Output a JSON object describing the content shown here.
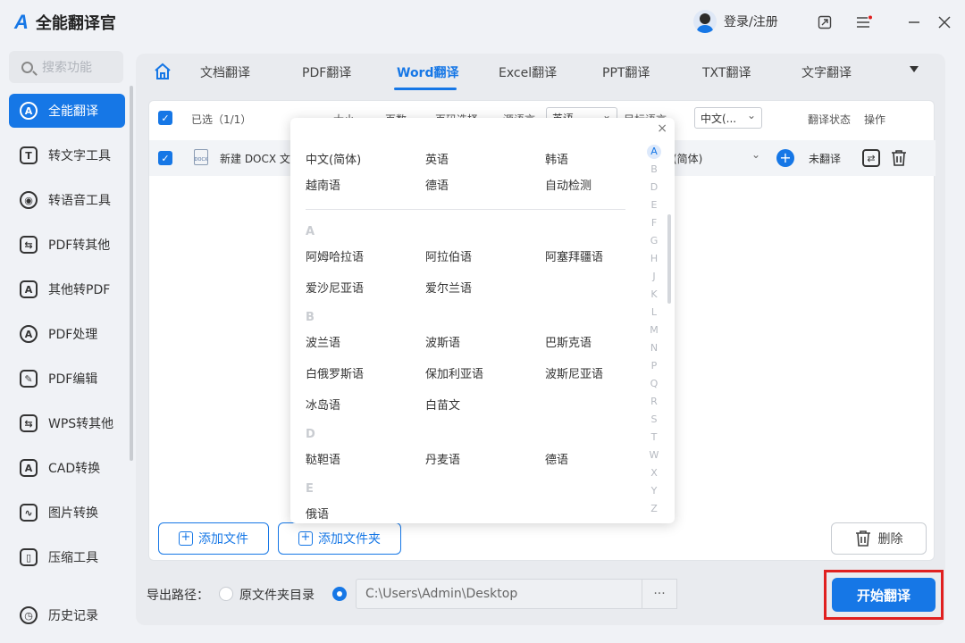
{
  "app": {
    "title": "全能翻译官",
    "logo": "A"
  },
  "header": {
    "login_label": "登录/注册"
  },
  "sidebar": {
    "search_placeholder": "搜索功能",
    "items": [
      {
        "label": "全能翻译",
        "icon": "A"
      },
      {
        "label": "转文字工具",
        "icon": "T"
      },
      {
        "label": "转语音工具",
        "icon": "◉"
      },
      {
        "label": "PDF转其他",
        "icon": "⇆"
      },
      {
        "label": "其他转PDF",
        "icon": "A"
      },
      {
        "label": "PDF处理",
        "icon": "A"
      },
      {
        "label": "PDF编辑",
        "icon": "✎"
      },
      {
        "label": "WPS转其他",
        "icon": "⇆"
      },
      {
        "label": "CAD转换",
        "icon": "A"
      },
      {
        "label": "图片转换",
        "icon": "∿"
      },
      {
        "label": "压缩工具",
        "icon": "▯"
      }
    ],
    "history_label": "历史记录"
  },
  "tabs": [
    "文档翻译",
    "PDF翻译",
    "Word翻译",
    "Excel翻译",
    "PPT翻译",
    "TXT翻译",
    "文字翻译"
  ],
  "active_tab": "Word翻译",
  "table": {
    "selected_label": "已选（1/1）",
    "col_size": "大小",
    "col_pages": "页数",
    "col_range": "页码选择",
    "col_source": "源语言",
    "source_value": "英语",
    "col_target": "目标语言",
    "target_value": "中文(...",
    "col_status": "翻译状态",
    "col_action": "操作",
    "row": {
      "filename": "新建 DOCX 文",
      "target_lang": "(简体)",
      "status": "未翻译",
      "doc_tag": "DOCX"
    }
  },
  "buttons": {
    "add_file": "添加文件",
    "add_folder": "添加文件夹",
    "delete": "删除",
    "start": "开始翻译"
  },
  "export": {
    "label": "导出路径：",
    "option_original": "原文件夹目录",
    "path": "C:\\Users\\Admin\\Desktop",
    "browse": "···"
  },
  "language_modal": {
    "close": "×",
    "common": [
      "中文(简体)",
      "英语",
      "韩语",
      "越南语",
      "德语",
      "自动检测"
    ],
    "sections": [
      {
        "letter": "A",
        "langs": [
          "阿姆哈拉语",
          "阿拉伯语",
          "阿塞拜疆语",
          "爱沙尼亚语",
          "爱尔兰语"
        ]
      },
      {
        "letter": "B",
        "langs": [
          "波兰语",
          "波斯语",
          "巴斯克语",
          "白俄罗斯语",
          "保加利亚语",
          "波斯尼亚语",
          "冰岛语",
          "白苗文"
        ]
      },
      {
        "letter": "D",
        "langs": [
          "鞑靼语",
          "丹麦语",
          "德语"
        ]
      },
      {
        "letter": "E",
        "langs": [
          "俄语"
        ]
      }
    ],
    "alphabet": [
      "A",
      "B",
      "D",
      "E",
      "F",
      "G",
      "H",
      "J",
      "K",
      "L",
      "M",
      "N",
      "P",
      "Q",
      "R",
      "S",
      "T",
      "W",
      "X",
      "Y",
      "Z"
    ],
    "active_letter": "A"
  }
}
